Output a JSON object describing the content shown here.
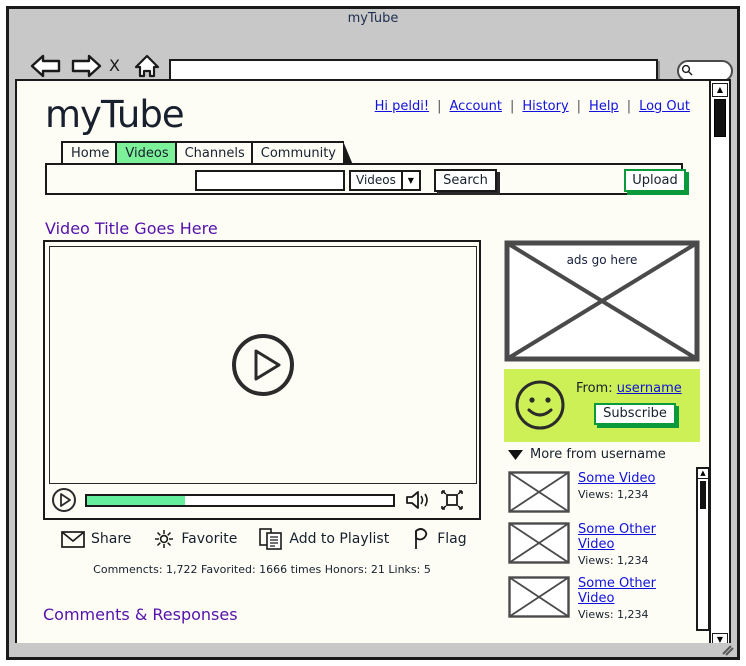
{
  "browser": {
    "title": "myTube",
    "address_value": "",
    "address_placeholder": "",
    "back_icon": "back-arrow-icon",
    "forward_icon": "forward-arrow-icon",
    "stop_icon": "X",
    "home_icon": "home-icon",
    "search_icon": "magnifier-icon"
  },
  "header": {
    "logo": "myTube",
    "nav": [
      {
        "label": "Hi peldi!"
      },
      {
        "label": "Account"
      },
      {
        "label": "History"
      },
      {
        "label": "Help"
      },
      {
        "label": "Log Out"
      }
    ],
    "divider": "|"
  },
  "tabs": [
    {
      "label": "Home",
      "active": false
    },
    {
      "label": "Videos",
      "active": true
    },
    {
      "label": "Channels",
      "active": false
    },
    {
      "label": "Community",
      "active": false
    }
  ],
  "search": {
    "input_value": "",
    "input_placeholder": "",
    "scope_label": "Videos",
    "scope_arrow": "▼",
    "search_label": "Search",
    "upload_label": "Upload"
  },
  "video": {
    "title": "Video Title Goes Here",
    "progress_percent": 32,
    "play_icon": "play-icon",
    "volume_icon": "speaker-icon",
    "fullscreen_icon": "fullscreen-icon"
  },
  "actions": [
    {
      "label": "Share",
      "icon": "envelope-icon"
    },
    {
      "label": "Favorite",
      "icon": "sparkle-star-icon"
    },
    {
      "label": "Add to Playlist",
      "icon": "documents-icon"
    },
    {
      "label": "Flag",
      "icon": "flag-icon"
    }
  ],
  "stats": "Commencts: 1,722 Favorited: 1666 times Honors: 21 Links: 5",
  "comments_heading": "Comments & Responses",
  "sidebar": {
    "ad_label": "ads go here",
    "from_label": "From:",
    "username": "username",
    "subscribe_label": "Subscribe",
    "more_from_label": "More from username",
    "more_from_icon": "triangle-down-icon",
    "related": [
      {
        "title": "Some Video",
        "views": "Views: 1,234"
      },
      {
        "title": "Some Other Video",
        "views": "Views: 1,234"
      },
      {
        "title": "Some Other Video",
        "views": "Views: 1,234"
      }
    ]
  },
  "scrollbars": {
    "up_arrow": "▲",
    "down_arrow": "▼"
  },
  "colors": {
    "accent_green": "#0a9a3c",
    "tab_active": "#7df09a",
    "panel_green": "#ccf055",
    "progress_green": "#63ef9b",
    "link_blue": "#1111dd",
    "heading_purple": "#5511aa"
  }
}
